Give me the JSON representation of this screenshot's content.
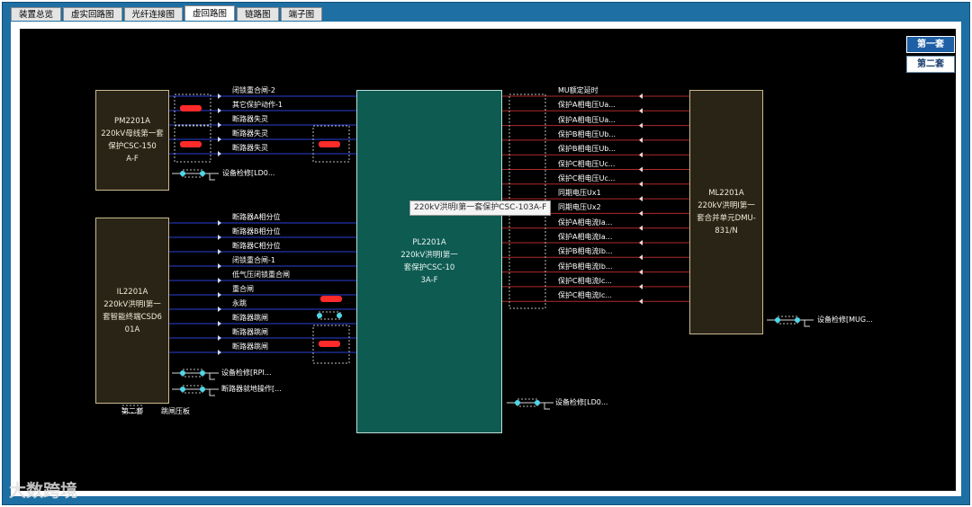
{
  "tabs": [
    "装置总览",
    "虚实回路图",
    "光纤连接图",
    "虚回路图",
    "链路图",
    "端子图"
  ],
  "active_tab": "虚回路图",
  "sets": {
    "first": "第一套",
    "second": "第二套"
  },
  "devices": {
    "pm": "PM2201A\n220kV母线第一套\n保护CSC-150\nA-F",
    "il": "IL2201A\n220kV洪明I第一\n套智能终端CSD6\n01A",
    "pl": "PL2201A\n220kV洪明I第一\n套保护CSC-10\n3A-F",
    "ml": "ML2201A\n220kV洪明I第一\n套合并单元DMU-\n831/N"
  },
  "signals_top_left": [
    "闭锁重合闸-2",
    "其它保护动作-1",
    "断路器失灵",
    "断路器失灵",
    "断路器失灵"
  ],
  "signals_bottom_left": [
    "断路器A相分位",
    "断路器B相分位",
    "断路器C相分位",
    "闭锁重合闸-1",
    "低气压闭锁重合闸",
    "重合闸",
    "永跳",
    "断路器跳闸",
    "断路器跳闸",
    "断路器跳闸"
  ],
  "signals_right": [
    "MU额定延时",
    "保护A相电压Ua...",
    "保护A相电压Ua...",
    "保护B相电压Ub...",
    "保护B相电压Ub...",
    "保护C相电压Uc...",
    "保护C相电压Uc...",
    "同期电压Ux1",
    "同期电压Ux2",
    "保护A相电流Ia...",
    "保护A相电流Ia...",
    "保护B相电流Ib...",
    "保护B相电流Ib...",
    "保护C相电流Ic...",
    "保护C相电流Ic..."
  ],
  "maintenance": {
    "pm": "设备检修[LD0...",
    "il_1": "设备检修[RPI...",
    "il_2": "断路器就地操作[...",
    "pl": "设备检修[LD0...",
    "ml": "设备检修[MUG..."
  },
  "tooltip": "220kV洪明I第一套保护CSC-103A-F",
  "under_il": {
    "left": "第二套",
    "right": "跳闸压板"
  },
  "watermark": "大数跨境",
  "colors": {
    "left_line": "#2a3fd6",
    "right_line": "#b02a2a",
    "strap": "#ff2a2a",
    "switch": "#4fd7e8"
  }
}
